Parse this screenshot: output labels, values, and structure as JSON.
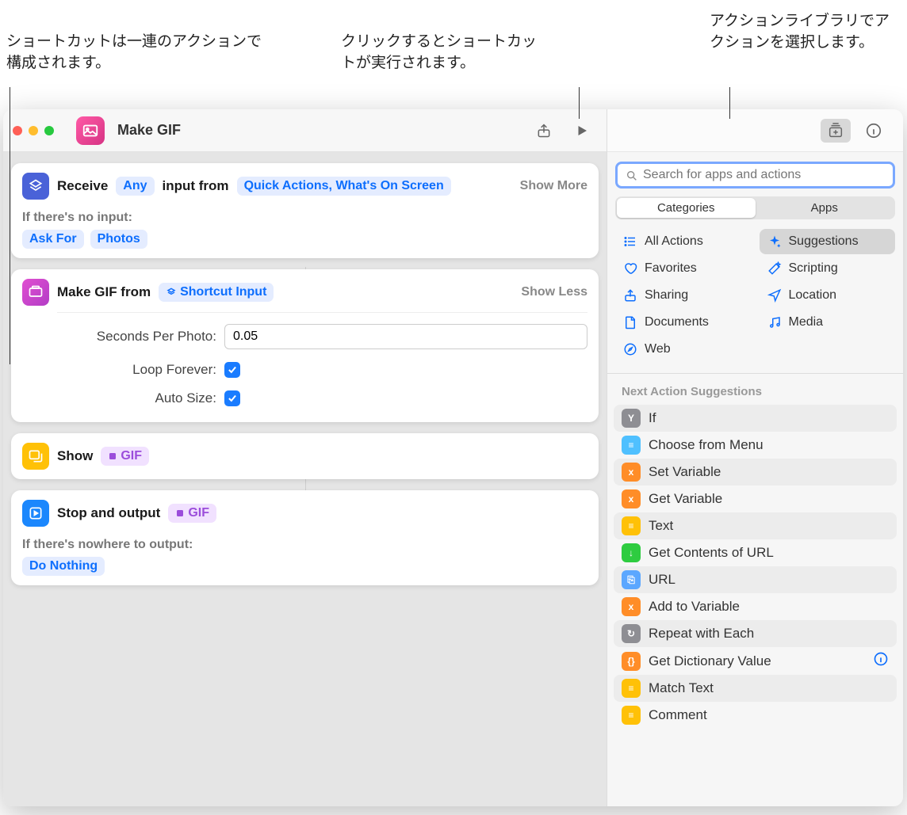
{
  "annotations": {
    "left": "ショートカットは一連のアクションで構成されます。",
    "center": "クリックするとショートカットが実行されます。",
    "right": "アクションライブラリでアクションを選択します。"
  },
  "toolbar": {
    "title": "Make GIF"
  },
  "actions": {
    "receive": {
      "prefix": "Receive",
      "any_token": "Any",
      "middle": "input from",
      "from_token": "Quick Actions, What's On Screen",
      "toggle": "Show More",
      "no_input_label": "If there's no input:",
      "no_input_tokens": [
        "Ask For",
        "Photos"
      ]
    },
    "make_gif": {
      "title": "Make GIF from",
      "input_token": "Shortcut Input",
      "toggle": "Show Less",
      "params": {
        "seconds_label": "Seconds Per Photo:",
        "seconds_value": "0.05",
        "loop_label": "Loop Forever:",
        "autosize_label": "Auto Size:"
      }
    },
    "show": {
      "title": "Show",
      "token": "GIF"
    },
    "output": {
      "title": "Stop and output",
      "token": "GIF",
      "nowhere_label": "If there's nowhere to output:",
      "nowhere_token": "Do Nothing"
    }
  },
  "library": {
    "search_placeholder": "Search for apps and actions",
    "tabs": {
      "categories": "Categories",
      "apps": "Apps"
    },
    "categories": [
      {
        "label": "All Actions",
        "icon": "list",
        "col": 0
      },
      {
        "label": "Suggestions",
        "icon": "sparkle",
        "col": 1,
        "selected": true
      },
      {
        "label": "Favorites",
        "icon": "heart",
        "col": 0
      },
      {
        "label": "Scripting",
        "icon": "wand",
        "col": 1
      },
      {
        "label": "Sharing",
        "icon": "share",
        "col": 0
      },
      {
        "label": "Location",
        "icon": "location",
        "col": 1
      },
      {
        "label": "Documents",
        "icon": "doc",
        "col": 0
      },
      {
        "label": "Media",
        "icon": "music",
        "col": 1
      },
      {
        "label": "Web",
        "icon": "safari",
        "col": 0
      }
    ],
    "suggestions_header": "Next Action Suggestions",
    "suggestions": [
      {
        "label": "If",
        "color": "#8e8e93",
        "glyph": "Y"
      },
      {
        "label": "Choose from Menu",
        "color": "#4fc0ff",
        "glyph": "≡"
      },
      {
        "label": "Set Variable",
        "color": "#ff8d28",
        "glyph": "x"
      },
      {
        "label": "Get Variable",
        "color": "#ff8d28",
        "glyph": "x"
      },
      {
        "label": "Text",
        "color": "#ffc107",
        "glyph": "≡"
      },
      {
        "label": "Get Contents of URL",
        "color": "#2ecc40",
        "glyph": "↓"
      },
      {
        "label": "URL",
        "color": "#5ba7ff",
        "glyph": "⎘"
      },
      {
        "label": "Add to Variable",
        "color": "#ff8d28",
        "glyph": "x"
      },
      {
        "label": "Repeat with Each",
        "color": "#8e8e93",
        "glyph": "↻"
      },
      {
        "label": "Get Dictionary Value",
        "color": "#ff8d28",
        "glyph": "{}",
        "info": true
      },
      {
        "label": "Match Text",
        "color": "#ffc107",
        "glyph": "≡"
      },
      {
        "label": "Comment",
        "color": "#ffc107",
        "glyph": "≡"
      }
    ]
  }
}
